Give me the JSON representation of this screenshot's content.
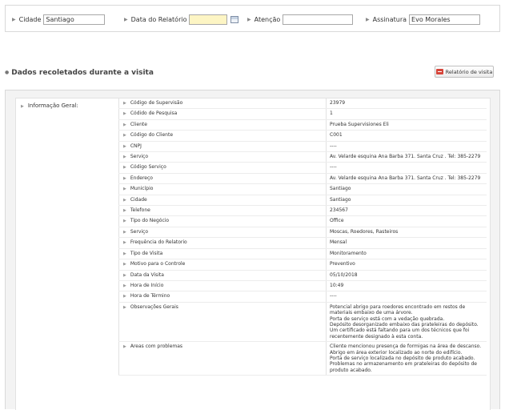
{
  "filters": {
    "cidade": {
      "label": "Cidade",
      "value": "Santiago"
    },
    "data_relatorio": {
      "label": "Data do Relatório",
      "value": ""
    },
    "atencao": {
      "label": "Atenção",
      "value": ""
    },
    "assinatura": {
      "label": "Assinatura",
      "value": "Evo Morales"
    }
  },
  "section": {
    "title": "Dados recoletados durante a visita",
    "report_button": "Relatório de visita"
  },
  "group": {
    "label": "Informação Geral:",
    "rows": [
      {
        "key": "Código de Supervisão",
        "value": "23979"
      },
      {
        "key": "Códido de Pesquisa",
        "value": "1"
      },
      {
        "key": "Cliente",
        "value": "Prueba Supervisiones Eli"
      },
      {
        "key": "Código do Cliente",
        "value": "C001"
      },
      {
        "key": "CNPJ",
        "value": "----"
      },
      {
        "key": "Serviço",
        "value": "Av. Velarde esquina Ana Barba 371. Santa Cruz . Tel: 385-2279"
      },
      {
        "key": "Código Serviço",
        "value": "----"
      },
      {
        "key": "Endereço",
        "value": "Av. Velarde esquina Ana Barba 371. Santa Cruz . Tel: 385-2279"
      },
      {
        "key": "Município",
        "value": "Santiago"
      },
      {
        "key": "Cidade",
        "value": "Santiago"
      },
      {
        "key": "Telefone",
        "value": "234567"
      },
      {
        "key": "Tipo do Negócio",
        "value": "Office"
      },
      {
        "key": "Serviço",
        "value": "Moscas, Roedores, Rasteiros"
      },
      {
        "key": "Frequência do Relatorio",
        "value": "Mensal"
      },
      {
        "key": "Tipo de Visita",
        "value": "Monitoramento"
      },
      {
        "key": "Motivo para o Controle",
        "value": "Preventivo"
      },
      {
        "key": "Data da Visita",
        "value": "05/10/2018"
      },
      {
        "key": "Hora de Início",
        "value": "10:49"
      },
      {
        "key": "Hora de Término",
        "value": "----"
      },
      {
        "key": "Observações Gerais",
        "value": "Potencial abrigo para roedores encontrado em restos de materiais embaixo de uma árvore.\nPorta de serviço está com a vedação quebrada.\nDepósito desorganizado embaixo das prateleiras do depósito.\nUm certificado está faltando para um dos técnicos que foi recentemente designado à esta conta."
      },
      {
        "key": "Areas com problemas",
        "value": "Cliente mencionou presença de formigas na área de descanso.\nAbrigo em área exterior localizado ao norte do edifício.\nPorta de serviço localizada no depósito de produto acabado.\nProblemas no armazenamento em prateleiras do depósito de produto acabado."
      }
    ]
  }
}
